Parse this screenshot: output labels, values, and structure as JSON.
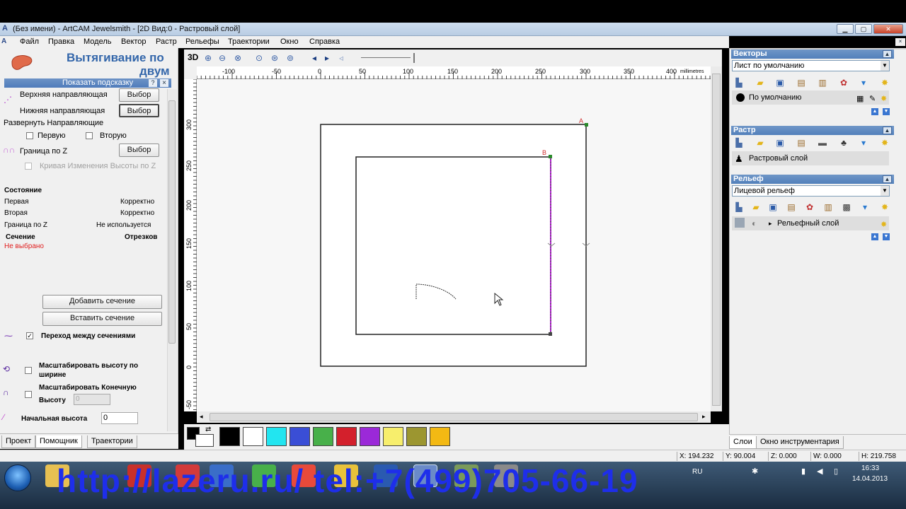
{
  "window": {
    "title": "(Без имени) - ArtCAM Jewelsmith - [2D Вид:0 - Растровый слой]"
  },
  "menu": [
    "Файл",
    "Правка",
    "Модель",
    "Вектор",
    "Растр",
    "Рельефы",
    "Траектории",
    "Окно",
    "Справка"
  ],
  "left_panel": {
    "title_line1": "Вытягивание по",
    "title_line2": "двум",
    "hint_bar": "Показать подсказку",
    "hint_help": "?",
    "hint_close": "×",
    "upper_guide_label": "Верхняя направляющая",
    "lower_guide_label": "Нижняя направляющая",
    "select_label": "Выбор",
    "reverse_guides": "Развернуть Направляющие",
    "first_label": "Первую",
    "second_label": "Вторую",
    "z_boundary": "Граница по Z",
    "height_curve": "Кривая Изменения Высоты по Z",
    "state_header": "Состояние",
    "state_rows": [
      {
        "name": "Первая",
        "value": "Корректно"
      },
      {
        "name": "Вторая",
        "value": "Корректно"
      },
      {
        "name": "Граница по Z",
        "value": "Не используется"
      }
    ],
    "section_label": "Сечение",
    "section_value": "Отрезков",
    "not_selected": "Не выбрано",
    "add_section": "Добавить сечение",
    "insert_section": "Вставить сечение",
    "transition": "Переход между сечениями",
    "scale_width_line1": "Масштабировать высоту по",
    "scale_width_line2": "ширине",
    "scale_end_line1": "Масштабировать Конечную",
    "scale_end_line2": "Высоту",
    "scale_end_value": "0",
    "start_height_label": "Начальная высота",
    "start_height_value": "0"
  },
  "left_tabs": [
    "Проект",
    "Помощник",
    "Траектории"
  ],
  "view_toolbar": {
    "mode_3d": "3D"
  },
  "ruler": {
    "h_ticks": [
      "-100",
      "-50",
      "0",
      "50",
      "100",
      "150",
      "200",
      "250",
      "300",
      "350",
      "400"
    ],
    "h_unit": "millimetres",
    "v_ticks": [
      "300",
      "250",
      "200",
      "150",
      "100",
      "50",
      "0",
      "-50"
    ]
  },
  "canvas": {
    "marker_a": "A",
    "marker_b": "B"
  },
  "palette": {
    "colors": [
      "#000000",
      "#ffffff",
      "#22e5f0",
      "#3a4ed6",
      "#48b04a",
      "#d3202c",
      "#9b29d8",
      "#f7ee6c",
      "#9c9630",
      "#f3b913"
    ]
  },
  "right_panel": {
    "vectors_header": "Векторы",
    "vectors_sheet": "Лист по умолчанию",
    "vectors_layer": "По умолчанию",
    "raster_header": "Растр",
    "raster_layer": "Растровый слой",
    "relief_header": "Рельеф",
    "relief_dropdown": "Лицевой рельеф",
    "relief_layer": "Рельефный слой"
  },
  "right_tabs": [
    "Слои",
    "Окно инструментария"
  ],
  "status": {
    "x": "X: 194.232",
    "y": "Y: 90.004",
    "z": "Z: 0.000",
    "w": "W: 0.000",
    "h": "H: 219.758"
  },
  "taskbar": {
    "lang": "RU",
    "time": "16:33",
    "date": "14.04.2013",
    "watermark": "http://lazeru.ru/  tel:+7(499)705-66-19"
  }
}
